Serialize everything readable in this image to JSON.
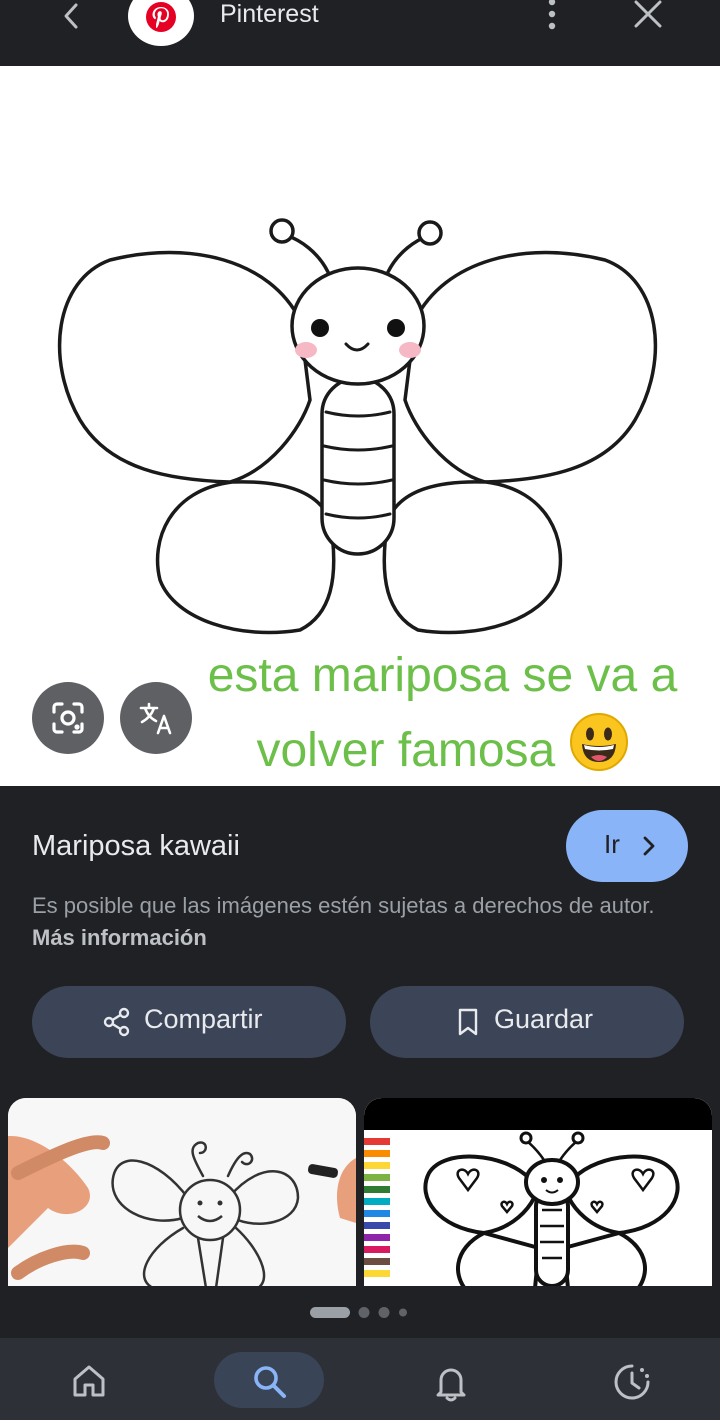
{
  "topbar": {
    "site_name": "Pinterest",
    "icons": [
      "back-arrow-icon",
      "pinterest-logo-icon",
      "more-vert-icon",
      "close-icon"
    ]
  },
  "image": {
    "caption_line1": "esta mariposa se va a",
    "caption_line2": "volver famosa",
    "caption_emoji": "grinning-face-emoji",
    "caption_color": "#6cc04a",
    "lens_icon": "google-lens-icon",
    "translate_icon": "translate-icon"
  },
  "result": {
    "title": "Mariposa kawaii",
    "go_label": "Ir",
    "copyright_note": "Es posible que las imágenes estén sujetas a derechos de autor.",
    "more_info": "Más información",
    "share_label": "Compartir",
    "save_label": "Guardar",
    "accent": "#8ab4f8"
  },
  "carousel": {
    "page_count": 4,
    "active_page": 1
  },
  "nav": {
    "items": [
      "home-icon",
      "search-icon",
      "notifications-icon",
      "history-icon"
    ],
    "active": "search-icon"
  }
}
